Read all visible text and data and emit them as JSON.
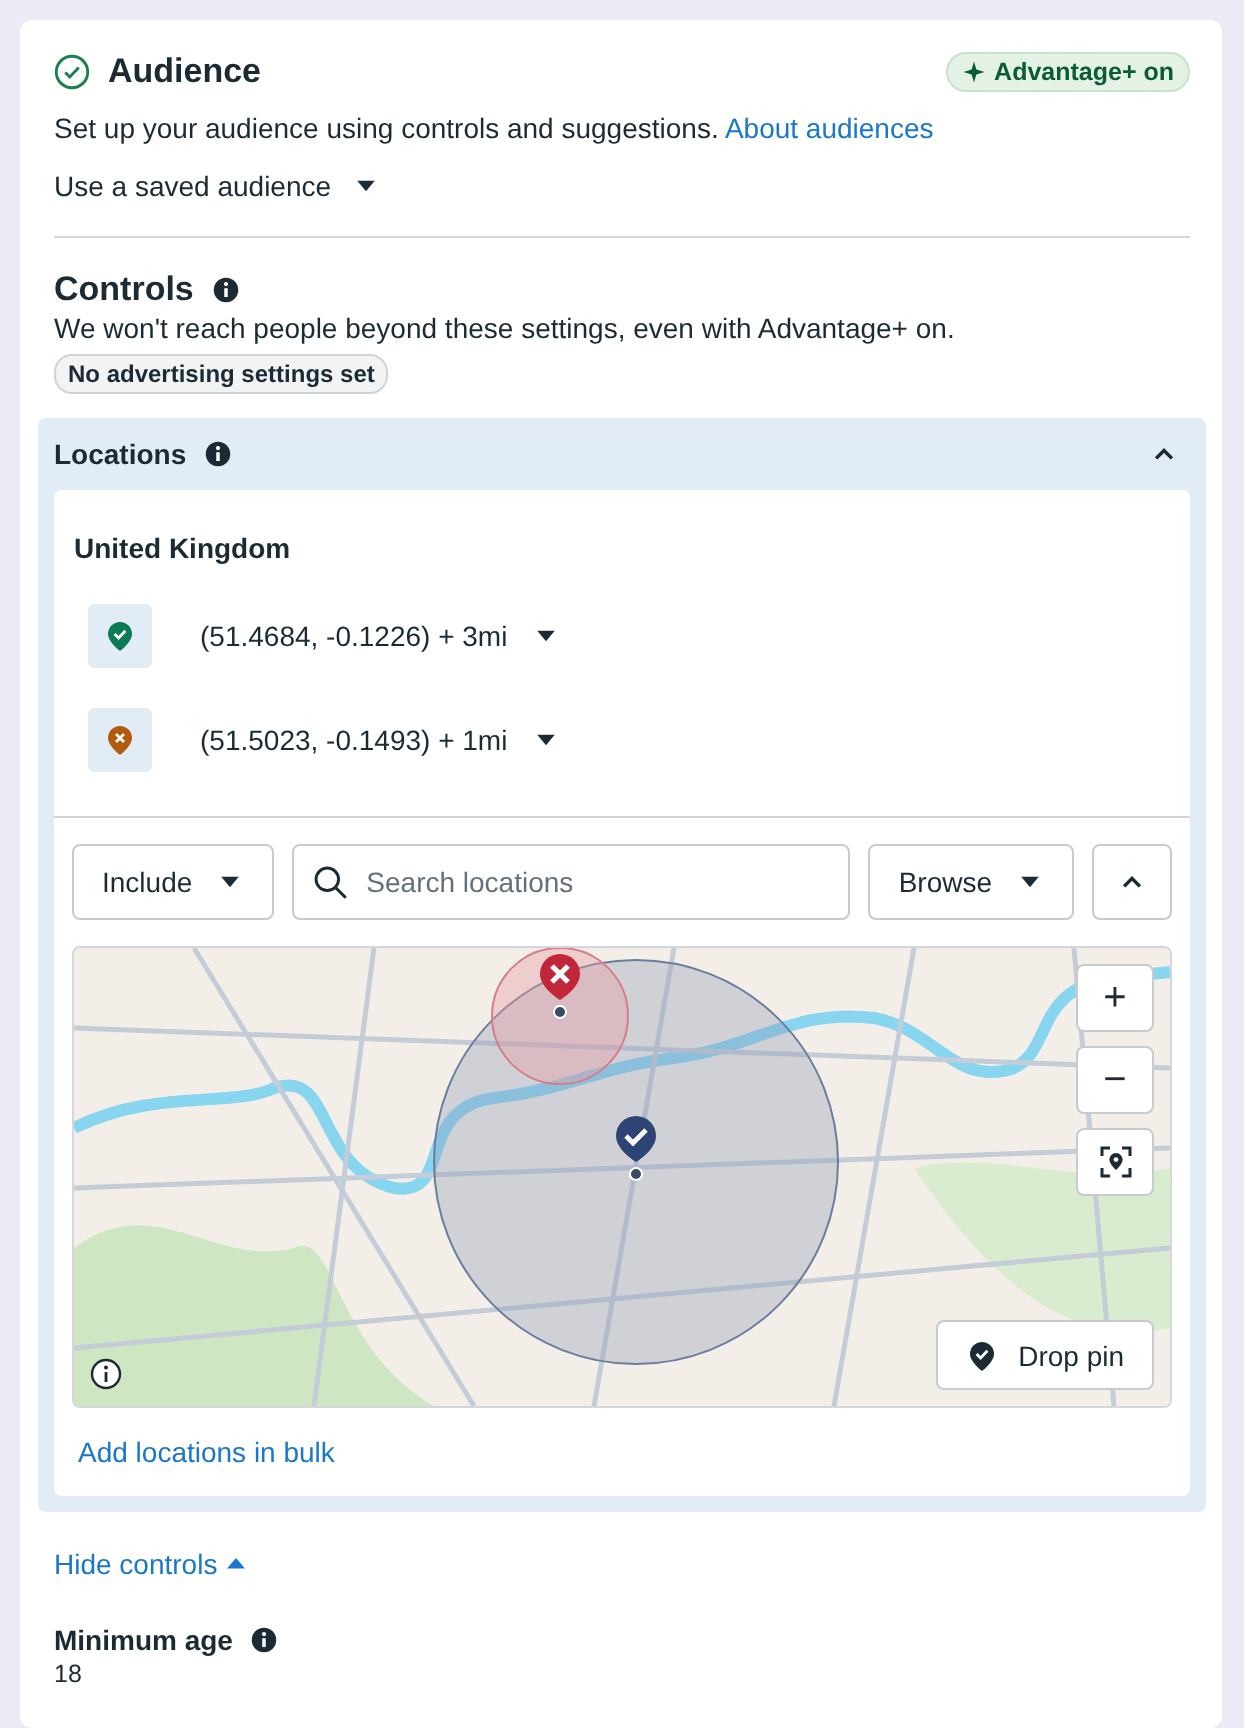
{
  "audience": {
    "title": "Audience",
    "badge": "Advantage+ on",
    "description": "Set up your audience using controls and suggestions.",
    "link": "About audiences",
    "saved_audience": "Use a saved audience"
  },
  "controls": {
    "title": "Controls",
    "description": "We won't reach people beyond these settings, even with Advantage+ on.",
    "tag": "No advertising settings set"
  },
  "locations": {
    "title": "Locations",
    "expanded": true,
    "country": "United Kingdom",
    "items": [
      {
        "kind": "include",
        "label": "(51.4684, -0.1226) + 3mi"
      },
      {
        "kind": "exclude",
        "label": "(51.5023, -0.1493) + 1mi"
      }
    ],
    "include_dropdown": "Include",
    "search": {
      "placeholder": "Search locations"
    },
    "browse": "Browse",
    "map": {
      "zoom_in": "+",
      "zoom_out": "−",
      "drop_pin": "Drop pin"
    },
    "bulk_link": "Add locations in bulk"
  },
  "hide_controls": "Hide controls",
  "minimum_age": {
    "label": "Minimum age",
    "value": "18"
  }
}
